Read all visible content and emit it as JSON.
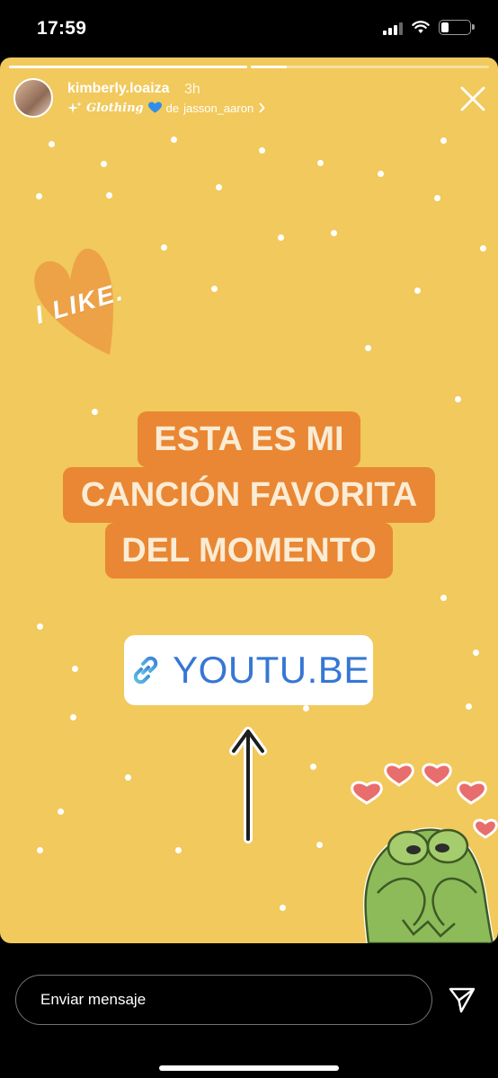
{
  "status_bar": {
    "time": "17:59"
  },
  "story": {
    "username": "kimberly.loaiza",
    "time_ago": "3h",
    "music_title": "Glothing",
    "music_prefix": "de",
    "music_artist": "jasson_aaron",
    "progress": [
      1.0,
      0.15
    ],
    "sticker_text": "I LIKE.",
    "headline_lines": [
      "ESTA ES MI",
      "CANCIÓN FAVORITA",
      "DEL MOMENTO"
    ],
    "link_text": "YOUTU.BE",
    "background_color": "#f1c95c",
    "headline_bg_color": "#e98734",
    "link_color": "#3677d4",
    "icons": [
      "close-icon",
      "sparkle-icon",
      "blue-heart-icon",
      "chevron-right-icon",
      "link-icon",
      "arrow-up-icon",
      "heart-icon",
      "kermit-sticker"
    ]
  },
  "message_bar": {
    "placeholder": "Enviar mensaje",
    "send_icon": "send-icon"
  }
}
